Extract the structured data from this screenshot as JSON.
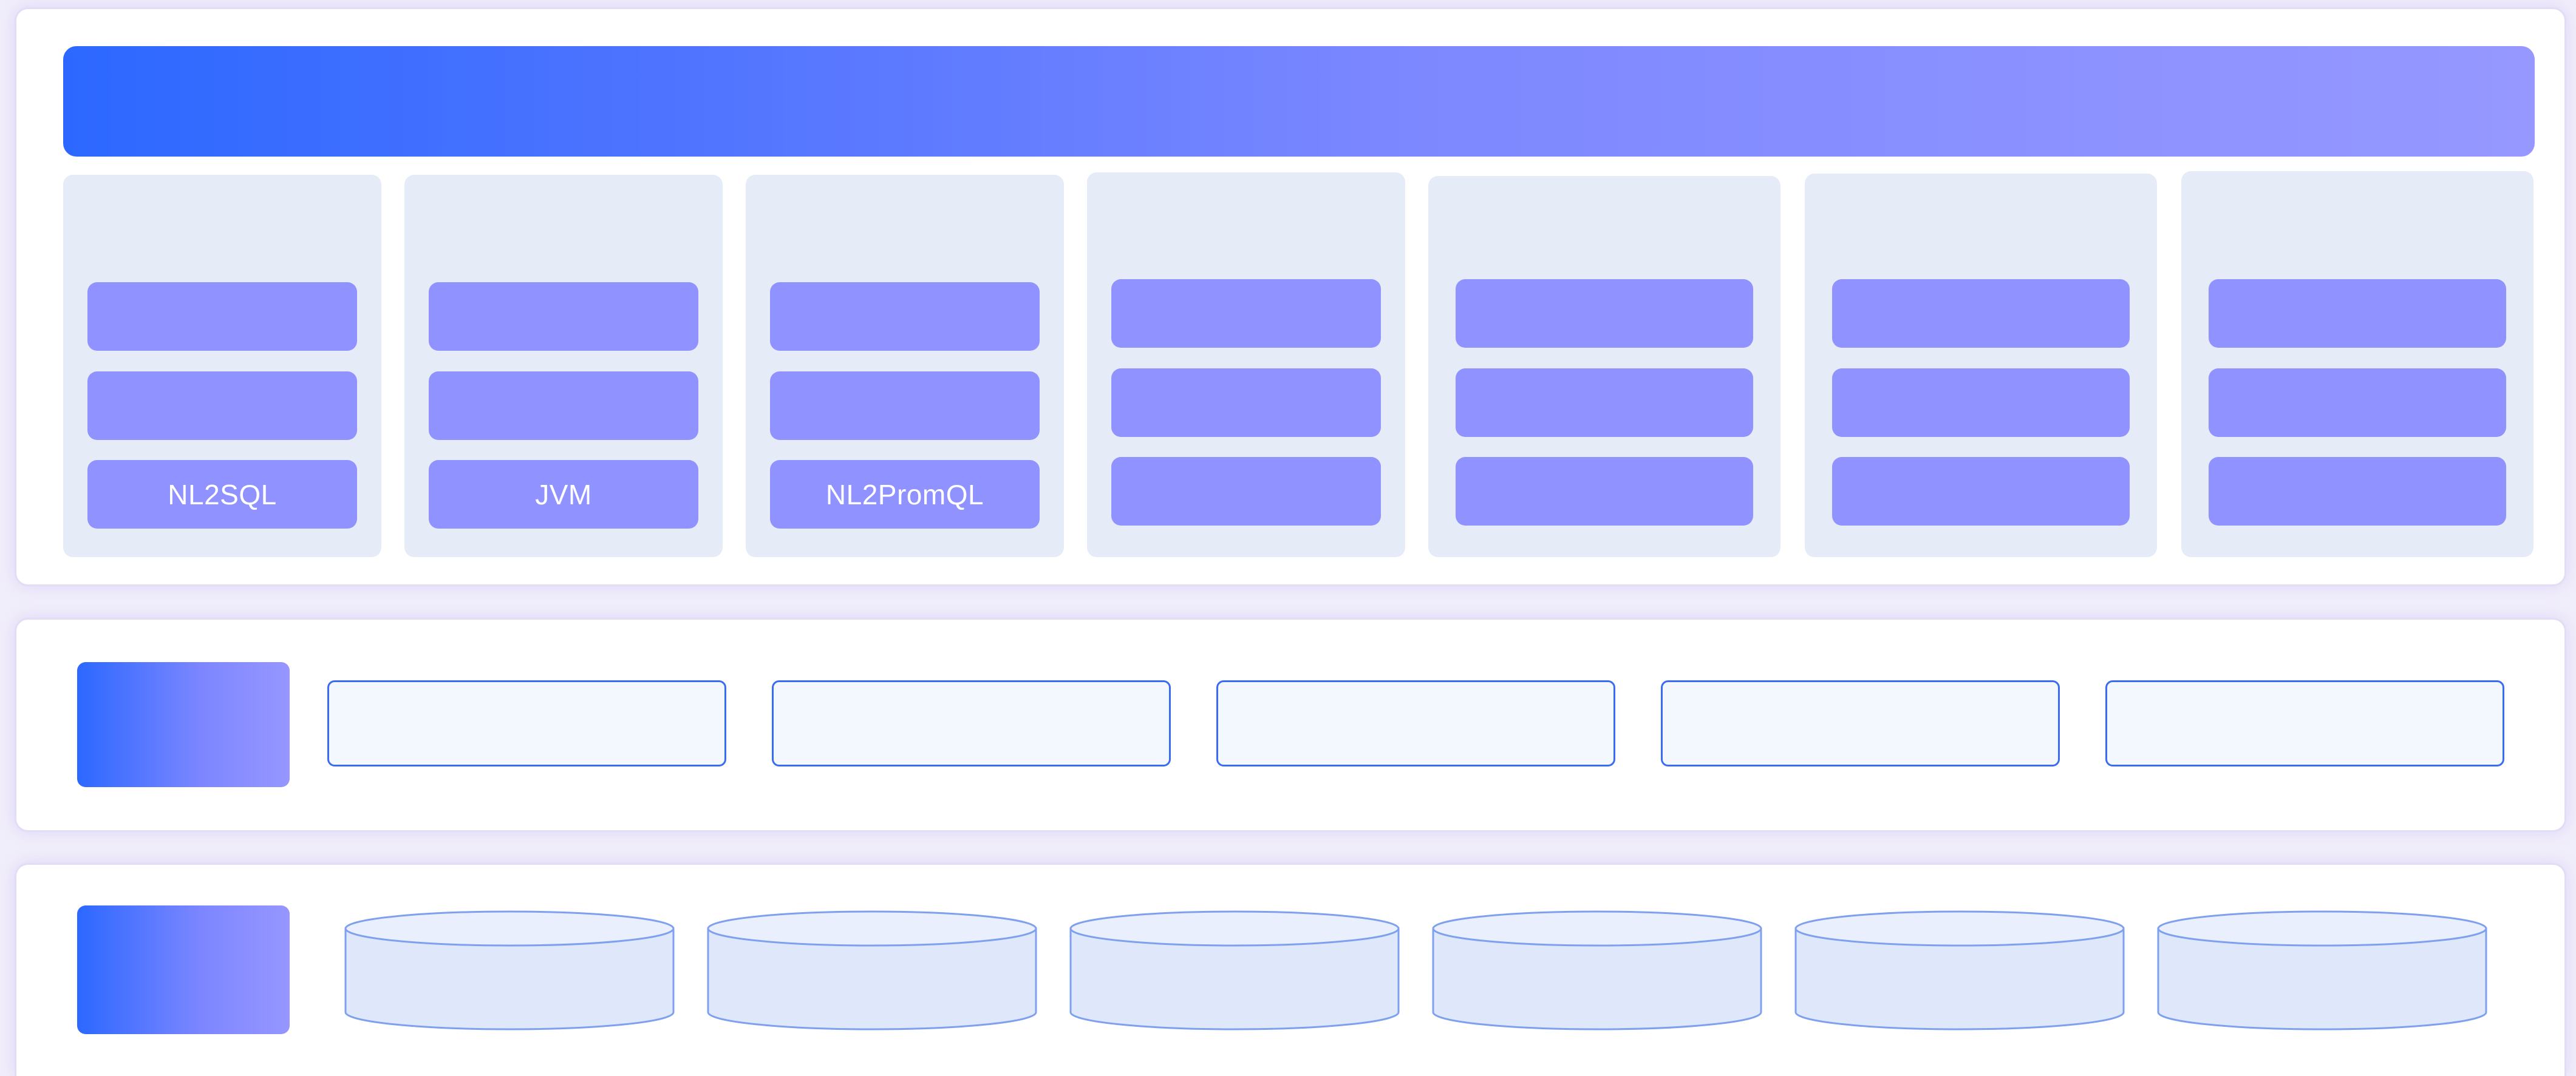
{
  "colors": {
    "gradient_start": "#2c68ff",
    "gradient_end": "#9698ff",
    "module": "#9092ff",
    "column_bg": "#e6ebf8",
    "service_border": "#3a6cf2",
    "service_bg": "#f2f8fd",
    "db_fill": "#dfe8fb",
    "db_stroke": "#7ea0ee"
  },
  "top_layer": {
    "header_text": "",
    "columns": [
      {
        "modules": [
          "",
          "",
          "NL2SQL"
        ]
      },
      {
        "modules": [
          "",
          "",
          "JVM"
        ]
      },
      {
        "modules": [
          "",
          "",
          "NL2PromQL"
        ]
      },
      {
        "modules": [
          "",
          "",
          ""
        ]
      },
      {
        "modules": [
          "",
          "",
          ""
        ]
      },
      {
        "modules": [
          "",
          "",
          ""
        ]
      },
      {
        "modules": [
          "",
          "",
          ""
        ]
      }
    ]
  },
  "middle_layer": {
    "label": "",
    "services": [
      "",
      "",
      "",
      "",
      ""
    ]
  },
  "bottom_layer": {
    "label": "",
    "databases": [
      "",
      "",
      "",
      "",
      "",
      ""
    ]
  }
}
